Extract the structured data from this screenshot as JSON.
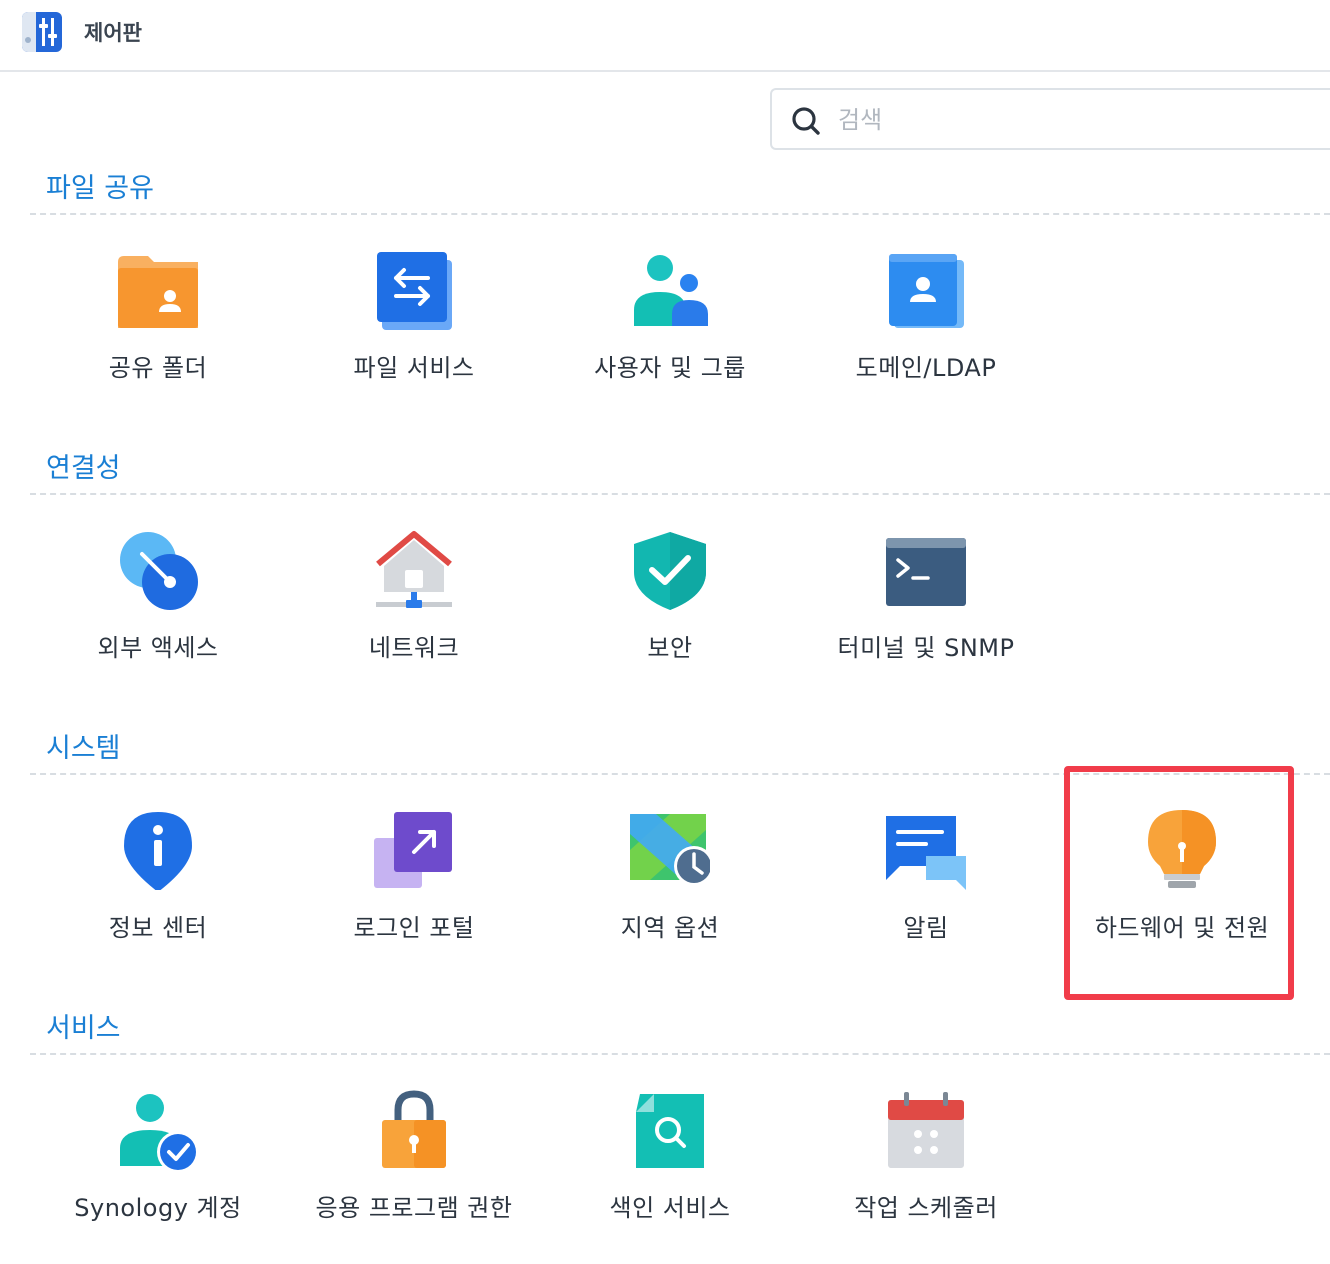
{
  "window": {
    "title": "제어판"
  },
  "search": {
    "placeholder": "검색",
    "value": ""
  },
  "sections": [
    {
      "title": "파일 공유",
      "items": [
        {
          "label": "공유 폴더",
          "icon": "shared-folder-icon"
        },
        {
          "label": "파일 서비스",
          "icon": "file-services-icon"
        },
        {
          "label": "사용자 및 그룹",
          "icon": "user-group-icon"
        },
        {
          "label": "도메인/LDAP",
          "icon": "domain-ldap-icon"
        }
      ]
    },
    {
      "title": "연결성",
      "items": [
        {
          "label": "외부 액세스",
          "icon": "external-access-icon"
        },
        {
          "label": "네트워크",
          "icon": "network-icon"
        },
        {
          "label": "보안",
          "icon": "security-shield-icon"
        },
        {
          "label": "터미널 및 SNMP",
          "icon": "terminal-icon"
        }
      ]
    },
    {
      "title": "시스템",
      "items": [
        {
          "label": "정보 센터",
          "icon": "info-center-icon"
        },
        {
          "label": "로그인 포털",
          "icon": "login-portal-icon"
        },
        {
          "label": "지역 옵션",
          "icon": "regional-options-icon"
        },
        {
          "label": "알림",
          "icon": "notification-icon"
        },
        {
          "label": "하드웨어 및 전원",
          "icon": "hardware-power-bulb-icon",
          "highlighted": true
        }
      ]
    },
    {
      "title": "서비스",
      "items": [
        {
          "label": "Synology 계정",
          "icon": "synology-account-icon"
        },
        {
          "label": "응용 프로그램 권한",
          "icon": "app-privileges-lock-icon"
        },
        {
          "label": "색인 서비스",
          "icon": "indexing-service-icon"
        },
        {
          "label": "작업 스케줄러",
          "icon": "task-scheduler-calendar-icon"
        }
      ]
    }
  ],
  "colors": {
    "section_title": "#1a7fd4",
    "highlight_border": "#f13c4a"
  }
}
